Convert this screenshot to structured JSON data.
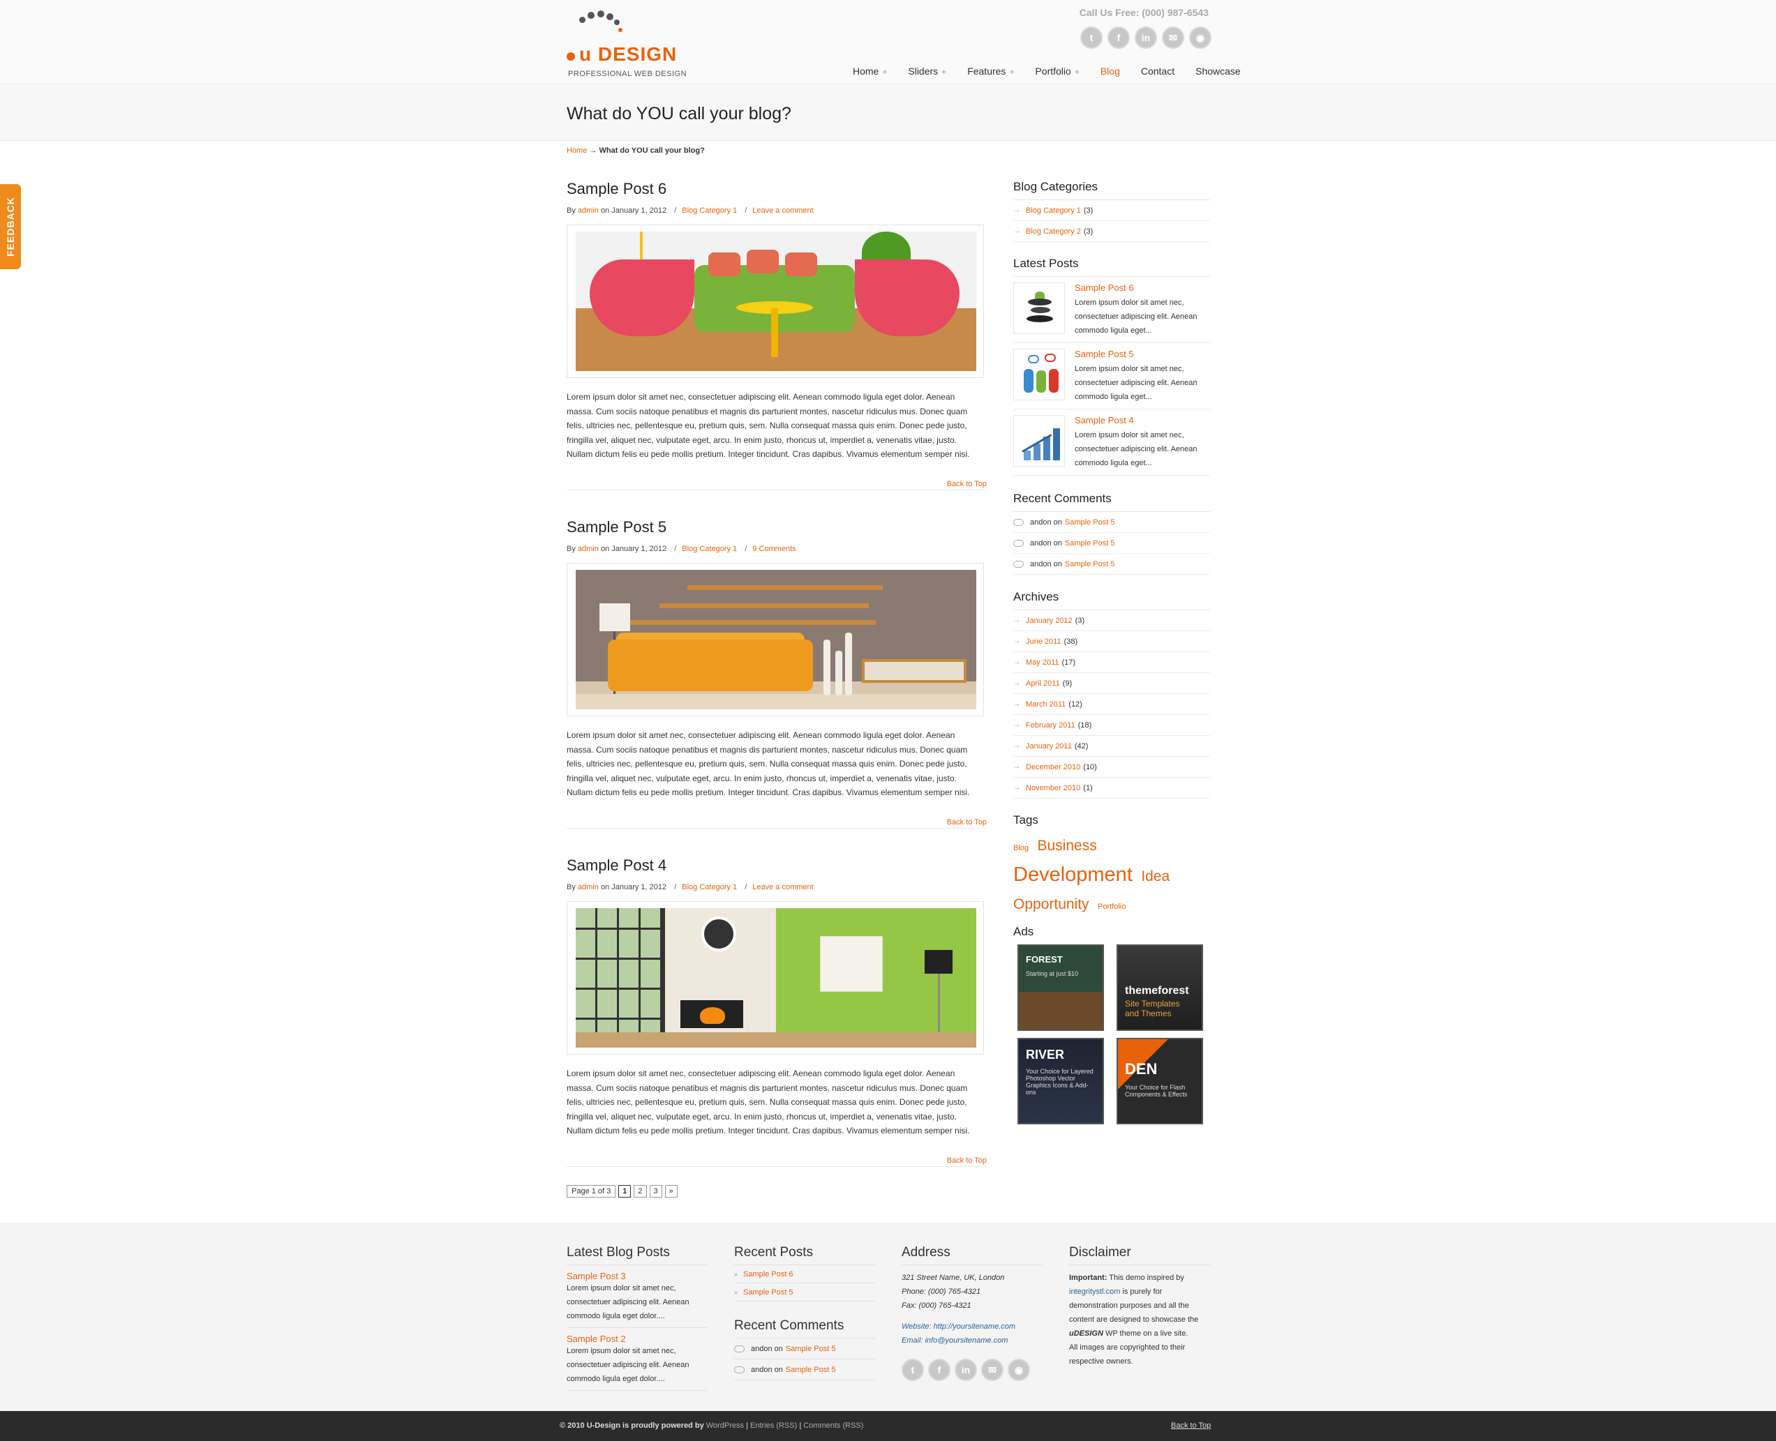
{
  "header": {
    "logo_text": "u DESIGN",
    "tagline": "PROFESSIONAL WEB DESIGN",
    "call_us": "Call Us Free: (000) 987-6543",
    "social": [
      "twitter-icon",
      "facebook-icon",
      "linkedin-icon",
      "email-icon",
      "rss-icon"
    ],
    "nav": [
      {
        "label": "Home",
        "has_sub": true
      },
      {
        "label": "Sliders",
        "has_sub": true
      },
      {
        "label": "Features",
        "has_sub": true
      },
      {
        "label": "Portfolio",
        "has_sub": true
      },
      {
        "label": "Blog",
        "active": true
      },
      {
        "label": "Contact"
      },
      {
        "label": "Showcase"
      }
    ]
  },
  "page_title": "What do YOU call your blog?",
  "breadcrumb": {
    "home": "Home",
    "sep": "→",
    "current": "What do YOU call your blog?"
  },
  "feedback_label": "FEEDBACK",
  "posts": [
    {
      "title": "Sample Post 6",
      "by": "By",
      "author": "admin",
      "date": "on January 1, 2012",
      "category": "Blog Category 1",
      "comments": "Leave a comment",
      "excerpt": "Lorem ipsum dolor sit amet nec, consectetuer adipiscing elit. Aenean commodo ligula eget dolor. Aenean massa. Cum sociis natoque penatibus et magnis dis parturient montes, nascetur ridiculus mus. Donec quam felis, ultricies nec, pellentesque eu, pretium quis, sem. Nulla consequat massa quis enim. Donec pede justo, fringilla vel, aliquet nec, vulputate eget, arcu. In enim justo, rhoncus ut, imperdiet a, venenatis vitae, justo. Nullam dictum felis eu pede mollis pretium. Integer tincidunt. Cras dapibus. Vivamus elementum semper nisi.",
      "back_to_top": "Back to Top"
    },
    {
      "title": "Sample Post 5",
      "by": "By",
      "author": "admin",
      "date": "on January 1, 2012",
      "category": "Blog Category 1",
      "comments": "9 Comments",
      "excerpt": "Lorem ipsum dolor sit amet nec, consectetuer adipiscing elit. Aenean commodo ligula eget dolor. Aenean massa. Cum sociis natoque penatibus et magnis dis parturient montes, nascetur ridiculus mus. Donec quam felis, ultricies nec, pellentesque eu, pretium quis, sem. Nulla consequat massa quis enim. Donec pede justo, fringilla vel, aliquet nec, vulputate eget, arcu. In enim justo, rhoncus ut, imperdiet a, venenatis vitae, justo. Nullam dictum felis eu pede mollis pretium. Integer tincidunt. Cras dapibus. Vivamus elementum semper nisi.",
      "back_to_top": "Back to Top"
    },
    {
      "title": "Sample Post 4",
      "by": "By",
      "author": "admin",
      "date": "on January 1, 2012",
      "category": "Blog Category 1",
      "comments": "Leave a comment",
      "excerpt": "Lorem ipsum dolor sit amet nec, consectetuer adipiscing elit. Aenean commodo ligula eget dolor. Aenean massa. Cum sociis natoque penatibus et magnis dis parturient montes, nascetur ridiculus mus. Donec quam felis, ultricies nec, pellentesque eu, pretium quis, sem. Nulla consequat massa quis enim. Donec pede justo, fringilla vel, aliquet nec, vulputate eget, arcu. In enim justo, rhoncus ut, imperdiet a, venenatis vitae, justo. Nullam dictum felis eu pede mollis pretium. Integer tincidunt. Cras dapibus. Vivamus elementum semper nisi.",
      "back_to_top": "Back to Top"
    }
  ],
  "pagination": {
    "label": "Page 1 of 3",
    "pages": [
      "1",
      "2",
      "3"
    ],
    "next": "»"
  },
  "sidebar": {
    "categories_title": "Blog Categories",
    "categories": [
      {
        "name": "Blog Category 1",
        "count": "(3)"
      },
      {
        "name": "Blog Category 2",
        "count": "(3)"
      }
    ],
    "latest_title": "Latest Posts",
    "latest": [
      {
        "title": "Sample Post 6",
        "excerpt": "Lorem ipsum dolor sit amet nec, consectetuer adipiscing elit. Aenean commodo ligula eget..."
      },
      {
        "title": "Sample Post 5",
        "excerpt": "Lorem ipsum dolor sit amet nec, consectetuer adipiscing elit. Aenean commodo ligula eget..."
      },
      {
        "title": "Sample Post 4",
        "excerpt": "Lorem ipsum dolor sit amet nec, consectetuer adipiscing elit. Aenean commodo ligula eget..."
      }
    ],
    "comments_title": "Recent Comments",
    "comments": [
      {
        "author": "andon",
        "on": "on",
        "post": "Sample Post 5"
      },
      {
        "author": "andon",
        "on": "on",
        "post": "Sample Post 5"
      },
      {
        "author": "andon",
        "on": "on",
        "post": "Sample Post 5"
      }
    ],
    "archives_title": "Archives",
    "archives": [
      {
        "name": "January 2012",
        "count": "(3)"
      },
      {
        "name": "June 2011",
        "count": "(38)"
      },
      {
        "name": "May 2011",
        "count": "(17)"
      },
      {
        "name": "April 2011",
        "count": "(9)"
      },
      {
        "name": "March 2011",
        "count": "(12)"
      },
      {
        "name": "February 2011",
        "count": "(18)"
      },
      {
        "name": "January 2011",
        "count": "(42)"
      },
      {
        "name": "December 2010",
        "count": "(10)"
      },
      {
        "name": "November 2010",
        "count": "(1)"
      }
    ],
    "tags_title": "Tags",
    "tags": [
      "Blog",
      "Business",
      "Development",
      "Idea",
      "Opportunity",
      "Portfolio"
    ],
    "ads_title": "Ads",
    "ads": [
      {
        "title": "FOREST",
        "sub": "Starting at just $10"
      },
      {
        "title": "themeforest",
        "sub": "Site Templates and Themes"
      },
      {
        "title": "RIVER",
        "sub": "Your Choice for Layered Photoshop Vector Graphics Icons & Add-ons"
      },
      {
        "title": "DEN",
        "sub": "Your Choice for Flash Components & Effects"
      }
    ]
  },
  "footer": {
    "latest_title": "Latest Blog Posts",
    "latest": [
      {
        "title": "Sample Post 3",
        "excerpt": "Lorem ipsum dolor sit amet nec, consectetuer adipiscing elit. Aenean commodo ligula eget dolor...."
      },
      {
        "title": "Sample Post 2",
        "excerpt": "Lorem ipsum dolor sit amet nec, consectetuer adipiscing elit. Aenean commodo ligula eget dolor...."
      }
    ],
    "recent_title": "Recent Posts",
    "recent": [
      "Sample Post 6",
      "Sample Post 5"
    ],
    "comments_title": "Recent Comments",
    "comments": [
      {
        "author": "andon",
        "on": "on",
        "post": "Sample Post 5"
      },
      {
        "author": "andon",
        "on": "on",
        "post": "Sample Post 5"
      }
    ],
    "address_title": "Address",
    "address": {
      "street": "321 Street Name, UK, London",
      "phone": "Phone: (000) 765-4321",
      "fax": "Fax: (000) 765-4321",
      "website": "Website: http://yoursitename.com",
      "email": "Email: info@yoursitename.com"
    },
    "disclaimer_title": "Disclaimer",
    "disclaimer": {
      "important": "Important:",
      "t1": "This demo inspired by",
      "link": "integritystl.com",
      "t2": "is purely for demonstration purposes and all the content are designed to showcase the",
      "brand": "uDESIGN",
      "t3": "WP theme on a live site.",
      "t4": "All images are copyrighted to their respective owners."
    }
  },
  "bottom": {
    "copyright": "© 2010 U-Design is proudly powered by",
    "wordpress": "WordPress",
    "entries": "Entries (RSS)",
    "comments_rss": "Comments (RSS)",
    "back_to_top": "Back to Top"
  },
  "colors": {
    "accent": "#e8620c",
    "footer_bg": "#f4f4f4",
    "bottom_bar": "#2b2b2b"
  }
}
